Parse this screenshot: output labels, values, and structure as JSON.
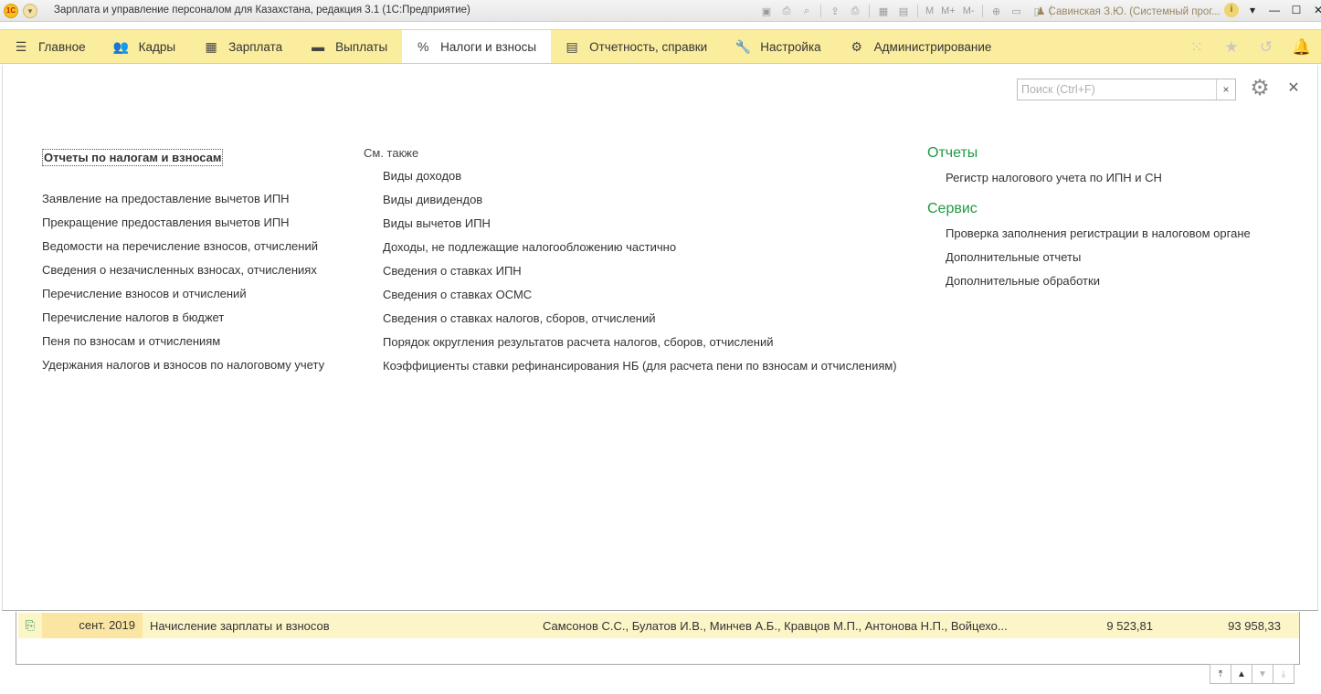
{
  "window": {
    "title": "Зарплата и управление персоналом для Казахстана, редакция 3.1  (1С:Предприятие)",
    "logo_text": "1С",
    "user": "Савинская З.Ю. (Системный прог...",
    "toolbar_labels": [
      "M",
      "M+",
      "M-"
    ]
  },
  "menubar": {
    "items": [
      {
        "label": "Главное",
        "icon": "hamburger-icon"
      },
      {
        "label": "Кадры",
        "icon": "people-icon"
      },
      {
        "label": "Зарплата",
        "icon": "calculator-icon"
      },
      {
        "label": "Выплаты",
        "icon": "wallet-icon"
      },
      {
        "label": "Налоги и взносы",
        "icon": "percent-icon"
      },
      {
        "label": "Отчетность, справки",
        "icon": "documents-icon"
      },
      {
        "label": "Настройка",
        "icon": "wrench-icon"
      },
      {
        "label": "Администрирование",
        "icon": "gear-icon"
      }
    ],
    "active": "Налоги и взносы",
    "right_icons": [
      "apps-grid-icon",
      "star-icon",
      "history-icon",
      "bell-icon"
    ]
  },
  "search": {
    "placeholder": "Поиск (Ctrl+F)",
    "value": ""
  },
  "left_section": {
    "header": "Отчеты по налогам и взносам",
    "links": [
      "Заявление на предоставление вычетов ИПН",
      "Прекращение предоставления вычетов ИПН",
      "Ведомости на перечисление взносов, отчислений",
      "Сведения о незачисленных взносах, отчислениях",
      "Перечисление взносов и отчислений",
      "Перечисление налогов в бюджет",
      "Пеня по взносам и отчислениям",
      "Удержания налогов и взносов по налоговому учету"
    ]
  },
  "see_also": {
    "header": "См. также",
    "links": [
      "Виды доходов",
      "Виды дивидендов",
      "Виды вычетов ИПН",
      "Доходы, не подлежащие налогообложению частично",
      "Сведения о ставках ИПН",
      "Сведения о ставках ОСМС",
      "Сведения о ставках налогов, сборов, отчислений",
      "Порядок округления результатов расчета налогов, сборов, отчислений",
      "Коэффициенты ставки рефинансирования НБ (для расчета пени по взносам и отчислениям)"
    ]
  },
  "reports": {
    "header": "Отчеты",
    "links": [
      "Регистр налогового учета по ИПН и СН"
    ]
  },
  "service": {
    "header": "Сервис",
    "links": [
      "Проверка заполнения регистрации в налоговом органе",
      "Дополнительные отчеты",
      "Дополнительные обработки"
    ]
  },
  "bottom_row": {
    "period": "сент. 2019",
    "document": "Начисление зарплаты и взносов",
    "employees": "Самсонов С.С., Булатов И.В., Минчев А.Б., Кравцов М.П., Антонова Н.П., Войцехо...",
    "amount1": "9 523,81",
    "amount2": "93 958,33"
  },
  "colors": {
    "menubar_bg": "#fbed9e",
    "section_title": "#1f9a41",
    "row_highlight": "#fcf5c8"
  }
}
